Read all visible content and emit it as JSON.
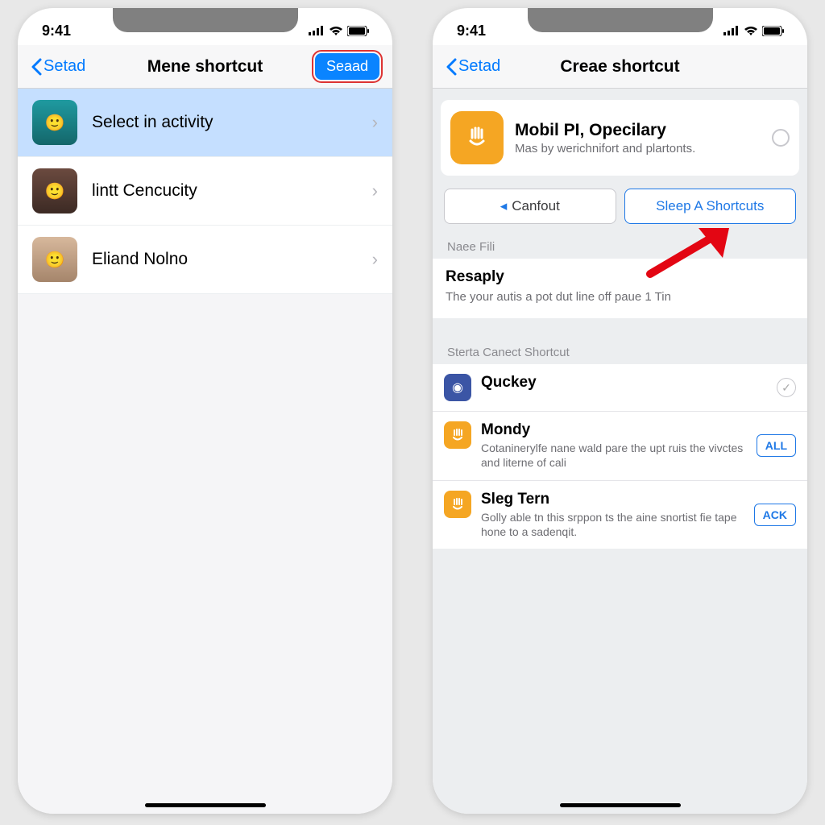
{
  "status": {
    "time": "9:41"
  },
  "left": {
    "back": "Setad",
    "title": "Mene shortcut",
    "action": "Seaad",
    "contacts": [
      {
        "name": "Select in activity",
        "avatarColor": "#1f9aa0",
        "selected": true
      },
      {
        "name": "lintt Cencucity",
        "avatarColor": "#5a3d34",
        "selected": false
      },
      {
        "name": "Eliand Nolno",
        "avatarColor": "#c7a489",
        "selected": false
      }
    ]
  },
  "right": {
    "back": "Setad",
    "title": "Creae shortcut",
    "card": {
      "title": "Mobil PI, Opecilary",
      "sub": "Mas by werichnifort and plartonts."
    },
    "seg": {
      "left": "Canfout",
      "right": "Sleep A Shortcuts"
    },
    "section1": "Naee Fili",
    "desc": {
      "title": "Resaply",
      "body": "The your autis a pot dut line off paue 1 Tin"
    },
    "section2": "Sterta Canect Shortcut",
    "shortcuts": [
      {
        "icon": "#3b55a5",
        "glyph": "◉",
        "title": "Quckey",
        "sub": "",
        "action": "check"
      },
      {
        "icon": "#f5a623",
        "glyph": "✋",
        "title": "Mondy",
        "sub": "Cotaninerylfe nane wald pare the upt ruis the vivctes and literne of cali",
        "action": "ALL"
      },
      {
        "icon": "#f5a623",
        "glyph": "✋",
        "title": "Sleg Tern",
        "sub": "Golly able tn this srppon ts the aine snortist fie tape hone to a sadenqit.",
        "action": "ACK"
      }
    ]
  }
}
